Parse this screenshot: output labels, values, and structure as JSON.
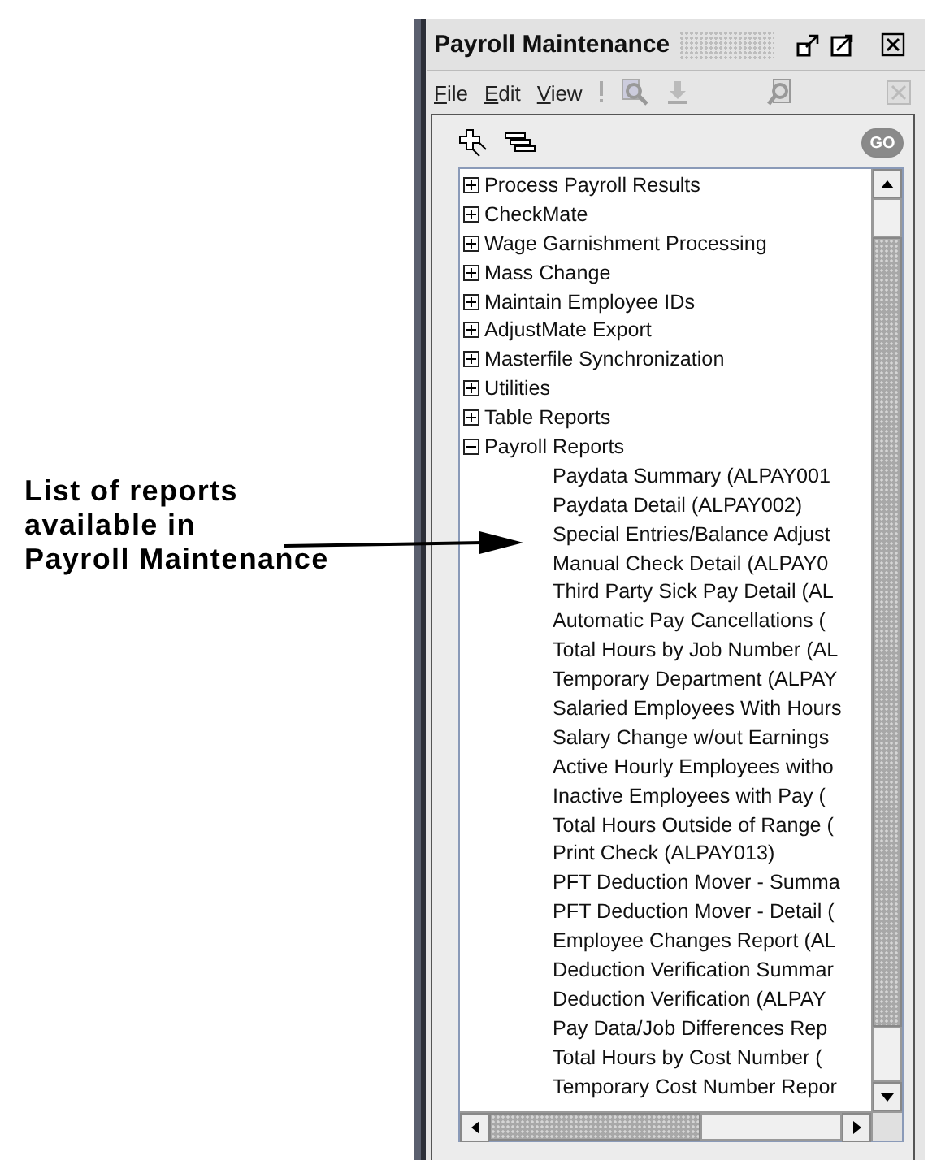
{
  "callout": {
    "lines": [
      "List of reports",
      "available in",
      "Payroll Maintenance"
    ]
  },
  "window": {
    "title": "Payroll Maintenance"
  },
  "menu": [
    {
      "label": "File"
    },
    {
      "label": "Edit"
    },
    {
      "label": "View"
    }
  ],
  "toolbar": {
    "go_button": {
      "label": "GO",
      "disabled": true
    }
  },
  "tree": [
    {
      "label": "Process Payroll Results",
      "expanded": false
    },
    {
      "label": "CheckMate",
      "expanded": false
    },
    {
      "label": "Wage Garnishment Processing",
      "expanded": false
    },
    {
      "label": "Mass Change",
      "expanded": false
    },
    {
      "label": "Maintain Employee IDs",
      "expanded": false
    },
    {
      "label": "AdjustMate Export",
      "expanded": false
    },
    {
      "label": "Masterfile Synchronization",
      "expanded": false
    },
    {
      "label": "Utilities",
      "expanded": false
    },
    {
      "label": "Table Reports",
      "expanded": false
    },
    {
      "label": "Payroll Reports",
      "expanded": true,
      "children": [
        {
          "label": "Paydata Summary (ALPAY001"
        },
        {
          "label": "Paydata Detail (ALPAY002)"
        },
        {
          "label": "Special Entries/Balance Adjust"
        },
        {
          "label": "Manual Check Detail (ALPAY0"
        },
        {
          "label": "Third Party Sick Pay Detail (AL"
        },
        {
          "label": "Automatic Pay Cancellations ("
        },
        {
          "label": "Total Hours by Job Number (AL"
        },
        {
          "label": "Temporary Department (ALPAY"
        },
        {
          "label": "Salaried Employees With Hours"
        },
        {
          "label": "Salary Change w/out Earnings"
        },
        {
          "label": "Active Hourly Employees witho"
        },
        {
          "label": "Inactive Employees with Pay ("
        },
        {
          "label": "Total Hours Outside of Range ("
        },
        {
          "label": "Print Check (ALPAY013)"
        },
        {
          "label": "PFT Deduction Mover - Summa"
        },
        {
          "label": "PFT Deduction Mover - Detail ("
        },
        {
          "label": "Employee Changes Report (AL"
        },
        {
          "label": "Deduction Verification Summar"
        },
        {
          "label": "Deduction Verification (ALPAY"
        },
        {
          "label": "Pay Data/Job Differences Rep"
        },
        {
          "label": "Total Hours by Cost Number ("
        },
        {
          "label": "Temporary Cost Number Repor"
        }
      ]
    }
  ]
}
